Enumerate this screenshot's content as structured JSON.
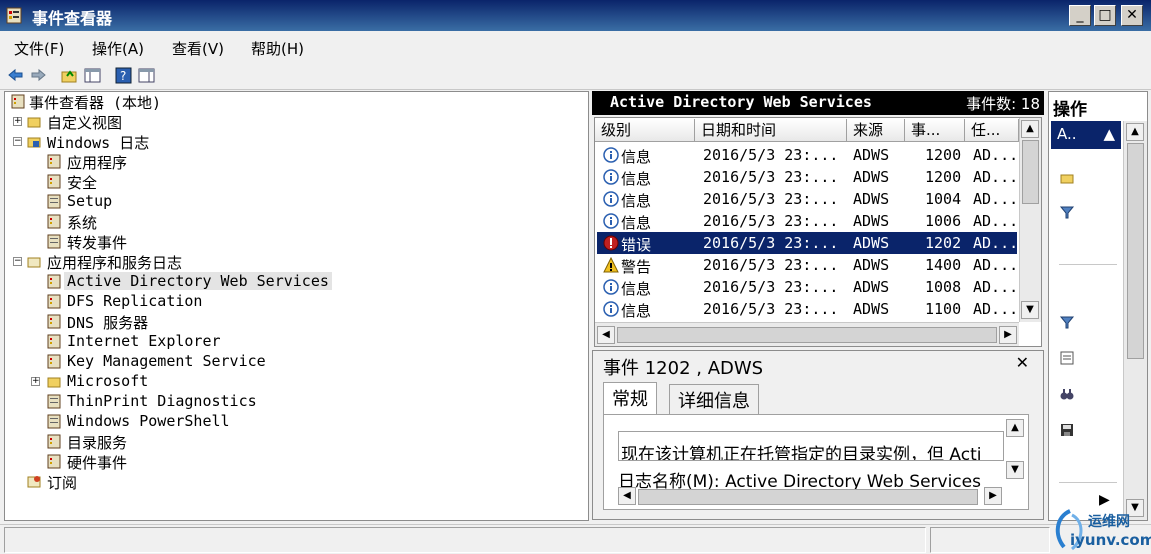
{
  "window": {
    "title": "事件查看器",
    "minimize_label": "_",
    "maximize_label": "□",
    "close_label": "✕"
  },
  "menu": {
    "items": [
      "文件(F)",
      "操作(A)",
      "查看(V)",
      "帮助(H)"
    ]
  },
  "tree": {
    "items": [
      {
        "label": "事件查看器 (本地)"
      },
      {
        "label": "自定义视图",
        "expander": "+"
      },
      {
        "label": "Windows 日志",
        "expander": "−"
      },
      {
        "label": "应用程序"
      },
      {
        "label": "安全"
      },
      {
        "label": "Setup"
      },
      {
        "label": "系统"
      },
      {
        "label": "转发事件"
      },
      {
        "label": "应用程序和服务日志",
        "expander": "−"
      },
      {
        "label": "Active Directory Web Services"
      },
      {
        "label": "DFS Replication"
      },
      {
        "label": "DNS 服务器"
      },
      {
        "label": "Internet Explorer"
      },
      {
        "label": "Key Management Service"
      },
      {
        "label": "Microsoft",
        "expander": "+"
      },
      {
        "label": "ThinPrint Diagnostics"
      },
      {
        "label": "Windows PowerShell"
      },
      {
        "label": "目录服务"
      },
      {
        "label": "硬件事件"
      },
      {
        "label": "订阅"
      }
    ]
  },
  "events": {
    "log_title": "Active Directory Web Services",
    "count_label": "事件数: 18",
    "columns": [
      "级别",
      "日期和时间",
      "来源",
      "事...",
      "任..."
    ],
    "rows": [
      {
        "level": "信息",
        "datetime": "2016/5/3 23:...",
        "source": "ADWS",
        "id": "1200",
        "task": "AD..."
      },
      {
        "level": "信息",
        "datetime": "2016/5/3 23:...",
        "source": "ADWS",
        "id": "1200",
        "task": "AD..."
      },
      {
        "level": "信息",
        "datetime": "2016/5/3 23:...",
        "source": "ADWS",
        "id": "1004",
        "task": "AD..."
      },
      {
        "level": "信息",
        "datetime": "2016/5/3 23:...",
        "source": "ADWS",
        "id": "1006",
        "task": "AD..."
      },
      {
        "level": "错误",
        "datetime": "2016/5/3 23:...",
        "source": "ADWS",
        "id": "1202",
        "task": "AD..."
      },
      {
        "level": "警告",
        "datetime": "2016/5/3 23:...",
        "source": "ADWS",
        "id": "1400",
        "task": "AD..."
      },
      {
        "level": "信息",
        "datetime": "2016/5/3 23:...",
        "source": "ADWS",
        "id": "1008",
        "task": "AD..."
      },
      {
        "level": "信息",
        "datetime": "2016/5/3 23:...",
        "source": "ADWS",
        "id": "1100",
        "task": "AD..."
      }
    ]
  },
  "detail": {
    "title": "事件 1202 , ADWS",
    "close_label": "✕",
    "tabs": [
      "常规",
      "详细信息"
    ],
    "message": "现在该计算机正在托管指定的目录实例，但 Acti",
    "log_name": "日志名称(M):  Active Directory Web Services"
  },
  "actions": {
    "title": "操作",
    "selected": "A.."
  },
  "watermark": {
    "line1": "运维网",
    "line2": "iyunv.com"
  },
  "colors": {
    "selection": "#0a246a",
    "title_gradient_start": "#0a246a",
    "title_gradient_end": "#3a6ea5"
  }
}
